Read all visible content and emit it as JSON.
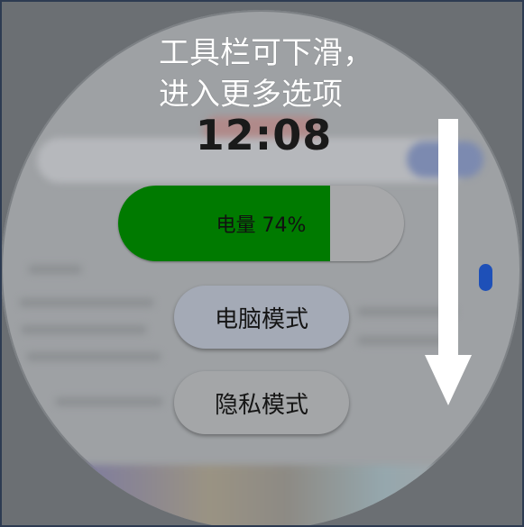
{
  "toolbar": {
    "time": "12:08",
    "battery": {
      "label": "电量 74%",
      "level": 0.74,
      "fill_color": "#007a00"
    },
    "buttons": [
      {
        "id": "pc",
        "label": "电脑模式"
      },
      {
        "id": "private",
        "label": "隐私模式"
      }
    ]
  },
  "hint": {
    "text": "工具栏可下滑，\n进入更多选项",
    "arrow_icon": "down-arrow-icon",
    "color": "#ffffff"
  },
  "background": {
    "accent": "#1e50b8"
  }
}
